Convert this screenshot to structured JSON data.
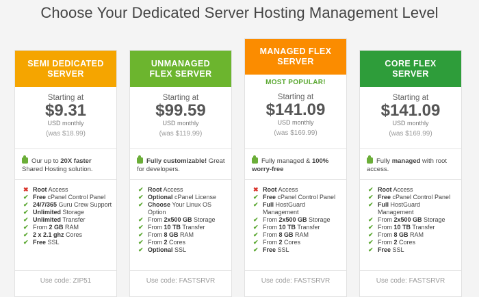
{
  "title": "Choose Your Dedicated Server Hosting Management Level",
  "plans": [
    {
      "name": "SEMI DEDICATED SERVER",
      "header_color": "#f5a500",
      "popular": "",
      "starting": "Starting at",
      "price": "$9.31",
      "period": "USD monthly",
      "was": "(was $18.99)",
      "highlight": {
        "pre": "Our up to ",
        "bold": "20X faster",
        "post": " Shared Hosting solution."
      },
      "features": [
        {
          "icon": "cross",
          "bold": "Root",
          "text": " Access"
        },
        {
          "icon": "check",
          "bold": "Free",
          "text": " cPanel Control Panel"
        },
        {
          "icon": "check",
          "bold": "24/7/365",
          "text": " Guru Crew Support"
        },
        {
          "icon": "check",
          "bold": "Unlimited",
          "text": " Storage"
        },
        {
          "icon": "check",
          "bold": "Unlimited",
          "text": " Transfer"
        },
        {
          "icon": "check",
          "bold": "",
          "text": "From ",
          "bold2": "2 GB",
          "text2": " RAM"
        },
        {
          "icon": "check",
          "bold": "2 x 2.1 ghz",
          "text": " Cores"
        },
        {
          "icon": "check",
          "bold": "Free",
          "text": " SSL"
        }
      ],
      "code": "Use code: ZIP51"
    },
    {
      "name": "UNMANAGED FLEX SERVER",
      "header_color": "#6cb52e",
      "popular": "",
      "starting": "Starting at",
      "price": "$99.59",
      "period": "USD monthly",
      "was": "(was $119.99)",
      "highlight": {
        "pre": "",
        "bold": "Fully customizable!",
        "post": " Great for developers."
      },
      "features": [
        {
          "icon": "check",
          "bold": "Root",
          "text": " Access"
        },
        {
          "icon": "check",
          "bold": "Optional",
          "text": " cPanel License"
        },
        {
          "icon": "check",
          "bold": "Choose",
          "text": " Your Linux OS Option"
        },
        {
          "icon": "check",
          "bold": "",
          "text": "From ",
          "bold2": "2x500 GB",
          "text2": " Storage"
        },
        {
          "icon": "check",
          "bold": "",
          "text": "From ",
          "bold2": "10 TB",
          "text2": " Transfer"
        },
        {
          "icon": "check",
          "bold": "",
          "text": "From ",
          "bold2": "8 GB",
          "text2": " RAM"
        },
        {
          "icon": "check",
          "bold": "",
          "text": "From ",
          "bold2": "2",
          "text2": " Cores"
        },
        {
          "icon": "check",
          "bold": "Optional",
          "text": " SSL"
        }
      ],
      "code": "Use code: FASTSRVR"
    },
    {
      "name": "MANAGED FLEX SERVER",
      "header_color": "#fb8c00",
      "popular": "MOST POPULAR!",
      "starting": "Starting at",
      "price": "$141.09",
      "period": "USD monthly",
      "was": "(was $169.99)",
      "highlight": {
        "pre": "Fully managed & ",
        "bold": "100% worry-free",
        "post": ""
      },
      "features": [
        {
          "icon": "cross",
          "bold": "Root",
          "text": " Access"
        },
        {
          "icon": "check",
          "bold": "Free",
          "text": " cPanel Control Panel"
        },
        {
          "icon": "check",
          "bold": "Full",
          "text": " HostGuard Management"
        },
        {
          "icon": "check",
          "bold": "",
          "text": "From ",
          "bold2": "2x500 GB",
          "text2": " Storage"
        },
        {
          "icon": "check",
          "bold": "",
          "text": "From ",
          "bold2": "10 TB",
          "text2": " Transfer"
        },
        {
          "icon": "check",
          "bold": "",
          "text": "From ",
          "bold2": "8 GB",
          "text2": " RAM"
        },
        {
          "icon": "check",
          "bold": "",
          "text": "From ",
          "bold2": "2",
          "text2": " Cores"
        },
        {
          "icon": "check",
          "bold": "Free",
          "text": " SSL"
        }
      ],
      "code": "Use code: FASTSRVR"
    },
    {
      "name": "CORE FLEX SERVER",
      "header_color": "#2e9d3a",
      "popular": "",
      "starting": "Starting at",
      "price": "$141.09",
      "period": "USD monthly",
      "was": "(was $169.99)",
      "highlight": {
        "pre": "Fully ",
        "bold": "managed",
        "post": " with root access."
      },
      "features": [
        {
          "icon": "check",
          "bold": "Root",
          "text": " Access"
        },
        {
          "icon": "check",
          "bold": "Free",
          "text": " cPanel Control Panel"
        },
        {
          "icon": "check",
          "bold": "Full",
          "text": " HostGuard Management"
        },
        {
          "icon": "check",
          "bold": "",
          "text": "From ",
          "bold2": "2x500 GB",
          "text2": " Storage"
        },
        {
          "icon": "check",
          "bold": "",
          "text": "From ",
          "bold2": "10 TB",
          "text2": " Transfer"
        },
        {
          "icon": "check",
          "bold": "",
          "text": "From ",
          "bold2": "8 GB",
          "text2": " RAM"
        },
        {
          "icon": "check",
          "bold": "",
          "text": "From ",
          "bold2": "2",
          "text2": " Cores"
        },
        {
          "icon": "check",
          "bold": "Free",
          "text": " SSL"
        }
      ],
      "code": "Use code: FASTSRVR"
    }
  ]
}
